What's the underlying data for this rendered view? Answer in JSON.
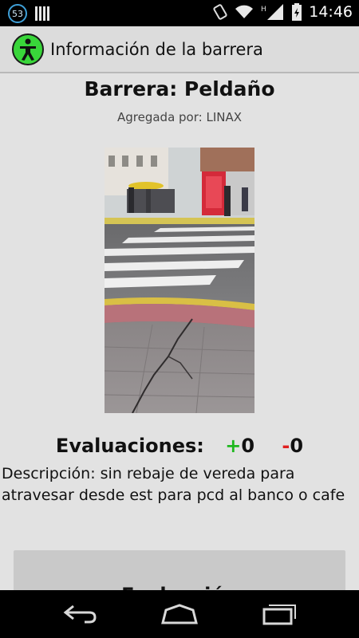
{
  "status_bar": {
    "notification_count": "53",
    "time": "14:46",
    "network_letter": "H",
    "icons": [
      "notification-badge-icon",
      "barcode-icon",
      "phone-rotate-icon",
      "wifi-icon",
      "cell-signal-icon",
      "battery-icon"
    ]
  },
  "action_bar": {
    "title": "Información de la barrera",
    "icon": "accessibility-person-icon",
    "icon_color": "#39d63a"
  },
  "barrier": {
    "title": "Barrera: Peldaño",
    "added_by_label": "Agregada por:",
    "added_by_user": "LINAX",
    "photo_icon": "street-crosswalk-photo"
  },
  "evaluations": {
    "label": "Evaluaciones:",
    "positive_sign": "+",
    "positive_count": "0",
    "negative_sign": "-",
    "negative_count": "0",
    "positive_color": "#1fb81f",
    "negative_color": "#e02020"
  },
  "description": {
    "text": "Descripción: sin rebaje de vereda para atravesar desde est para pcd al banco o cafe"
  },
  "button": {
    "label": "Evaluación"
  },
  "nav_bar": {
    "icons": [
      "back-icon",
      "home-icon",
      "recent-apps-icon"
    ]
  }
}
